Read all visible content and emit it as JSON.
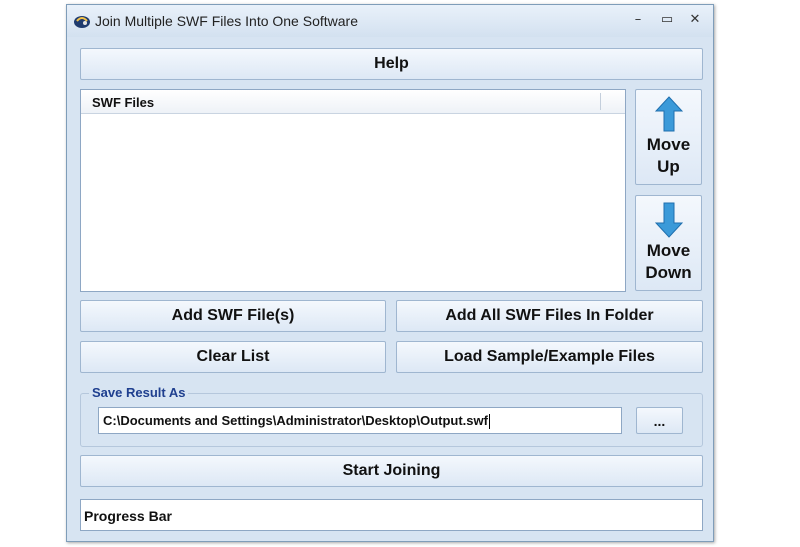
{
  "window": {
    "title": "Join Multiple SWF Files Into One Software",
    "controls": {
      "minimize": "–",
      "maximize": "▭",
      "close": "✕"
    }
  },
  "buttons": {
    "help": "Help",
    "move_up": {
      "line1": "Move",
      "line2": "Up"
    },
    "move_down": {
      "line1": "Move",
      "line2": "Down"
    },
    "add_files": "Add SWF File(s)",
    "add_folder": "Add All SWF Files In Folder",
    "clear_list": "Clear List",
    "load_sample": "Load Sample/Example Files",
    "browse": "...",
    "start": "Start Joining"
  },
  "file_list": {
    "column_header": "SWF Files",
    "items": []
  },
  "save_result": {
    "label": "Save Result As",
    "path": "C:\\Documents and Settings\\Administrator\\Desktop\\Output.swf"
  },
  "progress": {
    "label": "Progress Bar"
  },
  "icons": {
    "app": "swf-app-icon",
    "up": "arrow-up-icon",
    "down": "arrow-down-icon"
  },
  "colors": {
    "window_bg": "#d7e4f2",
    "arrow_blue": "#3b9ad9"
  }
}
